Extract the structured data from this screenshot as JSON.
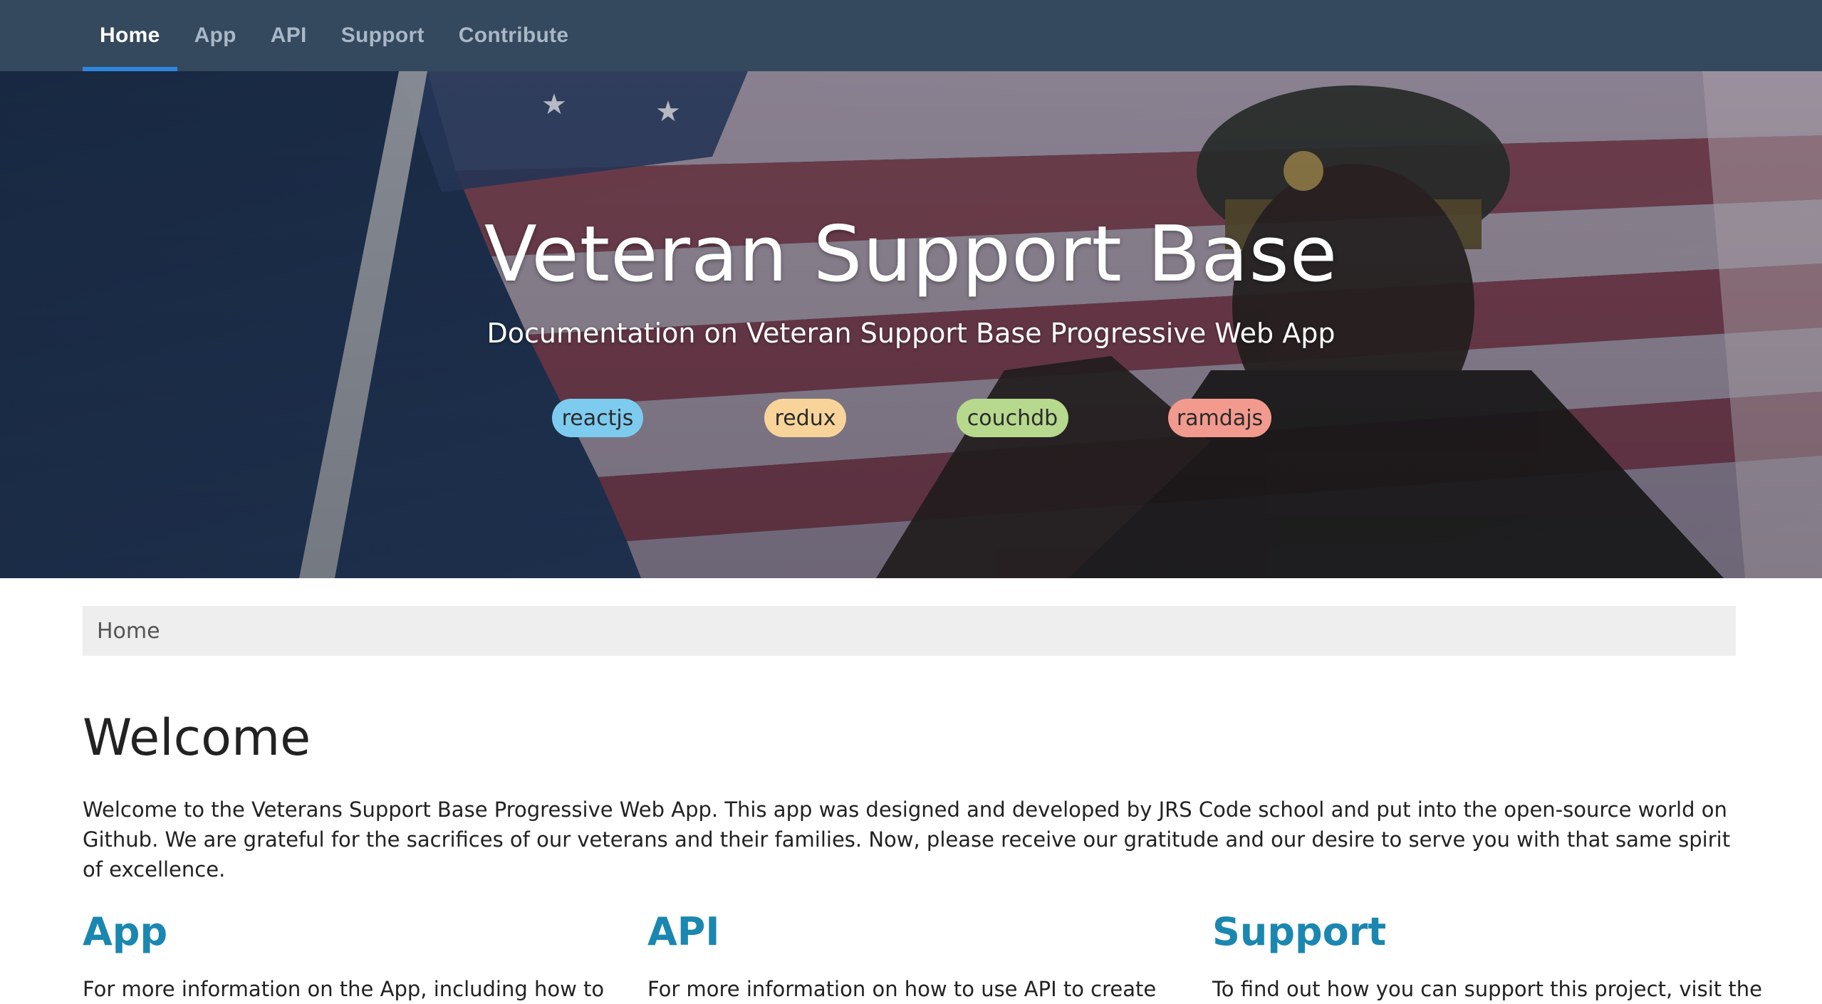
{
  "nav": {
    "items": [
      {
        "label": "Home",
        "active": true
      },
      {
        "label": "App",
        "active": false
      },
      {
        "label": "API",
        "active": false
      },
      {
        "label": "Support",
        "active": false
      },
      {
        "label": "Contribute",
        "active": false
      }
    ]
  },
  "hero": {
    "title": "Veteran Support Base",
    "subtitle": "Documentation on Veteran Support Base Progressive Web App",
    "tags": [
      {
        "label": "reactjs",
        "color": "#7ecbf0"
      },
      {
        "label": "redux",
        "color": "#f8d49a"
      },
      {
        "label": "couchdb",
        "color": "#b7d98e"
      },
      {
        "label": "ramdajs",
        "color": "#f29a8e"
      }
    ]
  },
  "breadcrumb": {
    "current": "Home"
  },
  "welcome": {
    "heading": "Welcome",
    "text": "Welcome to the Veterans Support Base Progressive Web App. This app was designed and developed by JRS Code school and put into the open-source world on Github. We are grateful for the sacrifices of our veterans and their families. Now, please receive our gratitude and our desire to serve you with that same spirit of excellence."
  },
  "sections": [
    {
      "heading": "App",
      "text": "For more information on the App, including how to"
    },
    {
      "heading": "API",
      "text": "For more information on how to use API to create"
    },
    {
      "heading": "Support",
      "text": "To find out how you can support this project, visit the"
    }
  ],
  "colors": {
    "navbar": "#34495e",
    "active_underline": "#2e86de",
    "link": "#1a87b0"
  }
}
